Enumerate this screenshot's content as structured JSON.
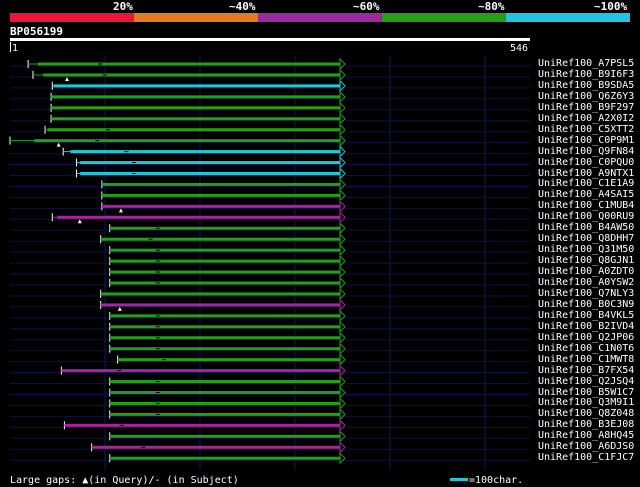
{
  "scale": {
    "labels": [
      "20%",
      "~40%",
      "~60%",
      "~80%",
      "~100%"
    ],
    "colors": [
      "#e8173a",
      "#e87818",
      "#a0289c",
      "#22a01a",
      "#1ec8d8"
    ]
  },
  "query": {
    "id": "BP056199",
    "start": "1",
    "end": "546",
    "length": 546
  },
  "hits": [
    {
      "name": "UniRef100_A7PSL5",
      "color": "green",
      "hstart": 30,
      "qs": 46,
      "qe": 546,
      "gap_q": false,
      "gap_s": true
    },
    {
      "name": "UniRef100_B9I6F3",
      "color": "green",
      "hstart": 38,
      "qs": 55,
      "qe": 546,
      "gap_q": true,
      "gap_s": true
    },
    {
      "name": "UniRef100_B9SDA5",
      "color": "cyan",
      "hstart": 70,
      "qs": 72,
      "qe": 546,
      "gap_q": false,
      "gap_s": false
    },
    {
      "name": "UniRef100_Q6Z6Y3",
      "color": "green",
      "hstart": 68,
      "qs": 68,
      "qe": 546,
      "gap_q": false,
      "gap_s": false
    },
    {
      "name": "UniRef100_B9F297",
      "color": "green",
      "hstart": 68,
      "qs": 68,
      "qe": 546,
      "gap_q": false,
      "gap_s": false
    },
    {
      "name": "UniRef100_A2X0I2",
      "color": "green",
      "hstart": 68,
      "qs": 68,
      "qe": 546,
      "gap_q": false,
      "gap_s": false
    },
    {
      "name": "UniRef100_C5XTT2",
      "color": "green",
      "hstart": 58,
      "qs": 62,
      "qe": 546,
      "gap_q": false,
      "gap_s": true
    },
    {
      "name": "UniRef100_C0P9M1",
      "color": "green",
      "hstart": 0,
      "qs": 40,
      "qe": 546,
      "gap_q": true,
      "gap_s": true
    },
    {
      "name": "UniRef100_Q9FN84",
      "color": "cyan",
      "hstart": 88,
      "qs": 100,
      "qe": 546,
      "gap_q": false,
      "gap_s": true
    },
    {
      "name": "UniRef100_C0PQU0",
      "color": "cyan",
      "hstart": 110,
      "qs": 116,
      "qe": 546,
      "gap_q": false,
      "gap_s": true
    },
    {
      "name": "UniRef100_A9NTX1",
      "color": "cyan",
      "hstart": 110,
      "qs": 116,
      "qe": 546,
      "gap_q": false,
      "gap_s": true
    },
    {
      "name": "UniRef100_C1E1A9",
      "color": "green",
      "hstart": 152,
      "qs": 152,
      "qe": 546,
      "gap_q": false,
      "gap_s": false
    },
    {
      "name": "UniRef100_A4SAI5",
      "color": "green",
      "hstart": 152,
      "qs": 152,
      "qe": 546,
      "gap_q": false,
      "gap_s": false
    },
    {
      "name": "UniRef100_C1MUB4",
      "color": "magenta",
      "hstart": 152,
      "qs": 152,
      "qe": 546,
      "gap_q": true,
      "gap_s": false
    },
    {
      "name": "UniRef100_Q00RU9",
      "color": "magenta",
      "hstart": 70,
      "qs": 78,
      "qe": 546,
      "gap_q": true,
      "gap_s": false
    },
    {
      "name": "UniRef100_B4AW50",
      "color": "green",
      "hstart": 165,
      "qs": 165,
      "qe": 546,
      "gap_q": false,
      "gap_s": true
    },
    {
      "name": "UniRef100_Q8DHH7",
      "color": "green",
      "hstart": 150,
      "qs": 150,
      "qe": 546,
      "gap_q": false,
      "gap_s": true
    },
    {
      "name": "UniRef100_Q31M50",
      "color": "green",
      "hstart": 165,
      "qs": 165,
      "qe": 546,
      "gap_q": false,
      "gap_s": true
    },
    {
      "name": "UniRef100_Q8GJN1",
      "color": "green",
      "hstart": 165,
      "qs": 165,
      "qe": 546,
      "gap_q": false,
      "gap_s": true
    },
    {
      "name": "UniRef100_A0ZDT0",
      "color": "green",
      "hstart": 165,
      "qs": 165,
      "qe": 546,
      "gap_q": false,
      "gap_s": true
    },
    {
      "name": "UniRef100_A0YSW2",
      "color": "green",
      "hstart": 165,
      "qs": 165,
      "qe": 546,
      "gap_q": false,
      "gap_s": true
    },
    {
      "name": "UniRef100_Q7NLY3",
      "color": "green",
      "hstart": 150,
      "qs": 150,
      "qe": 546,
      "gap_q": false,
      "gap_s": false
    },
    {
      "name": "UniRef100_B0C3N9",
      "color": "magenta",
      "hstart": 150,
      "qs": 150,
      "qe": 546,
      "gap_q": true,
      "gap_s": false
    },
    {
      "name": "UniRef100_B4VKL5",
      "color": "green",
      "hstart": 165,
      "qs": 165,
      "qe": 546,
      "gap_q": false,
      "gap_s": true
    },
    {
      "name": "UniRef100_B2IVD4",
      "color": "green",
      "hstart": 165,
      "qs": 165,
      "qe": 546,
      "gap_q": false,
      "gap_s": true
    },
    {
      "name": "UniRef100_Q2JP06",
      "color": "green",
      "hstart": 165,
      "qs": 165,
      "qe": 546,
      "gap_q": false,
      "gap_s": true
    },
    {
      "name": "UniRef100_C1N0T6",
      "color": "green",
      "hstart": 165,
      "qs": 165,
      "qe": 546,
      "gap_q": false,
      "gap_s": true
    },
    {
      "name": "UniRef100_C1MWT8",
      "color": "green",
      "hstart": 178,
      "qs": 178,
      "qe": 546,
      "gap_q": false,
      "gap_s": true
    },
    {
      "name": "UniRef100_B7FX54",
      "color": "magenta",
      "hstart": 85,
      "qs": 85,
      "qe": 546,
      "gap_q": false,
      "gap_s": true
    },
    {
      "name": "UniRef100_Q2JSQ4",
      "color": "green",
      "hstart": 165,
      "qs": 165,
      "qe": 546,
      "gap_q": false,
      "gap_s": true
    },
    {
      "name": "UniRef100_B5W1C7",
      "color": "green",
      "hstart": 165,
      "qs": 165,
      "qe": 546,
      "gap_q": false,
      "gap_s": true
    },
    {
      "name": "UniRef100_Q3M9I1",
      "color": "green",
      "hstart": 165,
      "qs": 165,
      "qe": 546,
      "gap_q": false,
      "gap_s": true
    },
    {
      "name": "UniRef100_Q8Z048",
      "color": "green",
      "hstart": 165,
      "qs": 165,
      "qe": 546,
      "gap_q": false,
      "gap_s": true
    },
    {
      "name": "UniRef100_B3EJ08",
      "color": "magenta",
      "hstart": 90,
      "qs": 90,
      "qe": 546,
      "gap_q": false,
      "gap_s": true
    },
    {
      "name": "UniRef100_A8HQ45",
      "color": "green",
      "hstart": 165,
      "qs": 165,
      "qe": 546,
      "gap_q": false,
      "gap_s": false
    },
    {
      "name": "UniRef100_A6DJS0",
      "color": "magenta",
      "hstart": 135,
      "qs": 135,
      "qe": 546,
      "gap_q": false,
      "gap_s": true
    },
    {
      "name": "UniRef100_C1FJC7",
      "color": "green",
      "hstart": 165,
      "qs": 165,
      "qe": 546,
      "gap_q": false,
      "gap_s": false
    }
  ],
  "legend": {
    "large_gaps": "Large gaps: ▲(in Query)/- (in Subject)",
    "scale_label": "=100char."
  }
}
